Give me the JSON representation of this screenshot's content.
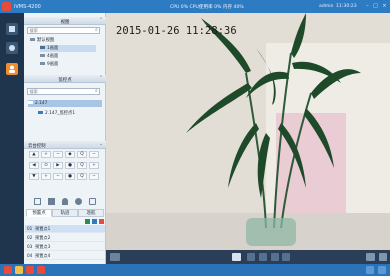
{
  "app": {
    "title": "iVMS-4200"
  },
  "topbar": {
    "cpu_status": "CPU 0%  CPU使用率 0%  内存 40%",
    "user": "admin",
    "time": "11:30:23",
    "min_label": "–",
    "max_label": "□",
    "close_label": "×"
  },
  "panel": {
    "view_title": "视图",
    "search_placeholder": "搜索",
    "tree": [
      {
        "label": "默认视图"
      },
      {
        "label": "1画面"
      },
      {
        "label": "4画面"
      },
      {
        "label": "9画面"
      }
    ],
    "camera_title": "监控点",
    "camera_search_placeholder": "搜索",
    "camera_group": "2.147",
    "camera_item": "2.147_监控点1",
    "ptz_title": "云台控制",
    "ptz_buttons": [
      "▲",
      "+",
      "−",
      "◆",
      "Q",
      "−",
      "◀",
      "⊙",
      "▶",
      "●",
      "Q",
      "+",
      "▼",
      "+",
      "−",
      "●",
      "Q",
      "−"
    ],
    "tabs": [
      "预置点",
      "轨迹",
      "巡航"
    ],
    "presets": [
      {
        "num": "01",
        "label": "预置点1"
      },
      {
        "num": "02",
        "label": "预置点2"
      },
      {
        "num": "03",
        "label": "预置点3"
      },
      {
        "num": "04",
        "label": "预置点4"
      }
    ]
  },
  "video": {
    "timestamp": "2015-01-26 11:28:36"
  },
  "colors": {
    "topbar": "#2d7cc3",
    "rail": "#1f354d",
    "ctrlbar": "#2a3f57",
    "taskbar": "#2b73b9",
    "accent_red": "#e84b3a"
  },
  "icons": {
    "rail": [
      "live-view-icon",
      "camera-icon",
      "user-icon"
    ],
    "ctrl": [
      "layout-icon",
      "stop-icon",
      "prev-icon",
      "play-icon",
      "next-icon",
      "fullscreen-icon"
    ]
  }
}
